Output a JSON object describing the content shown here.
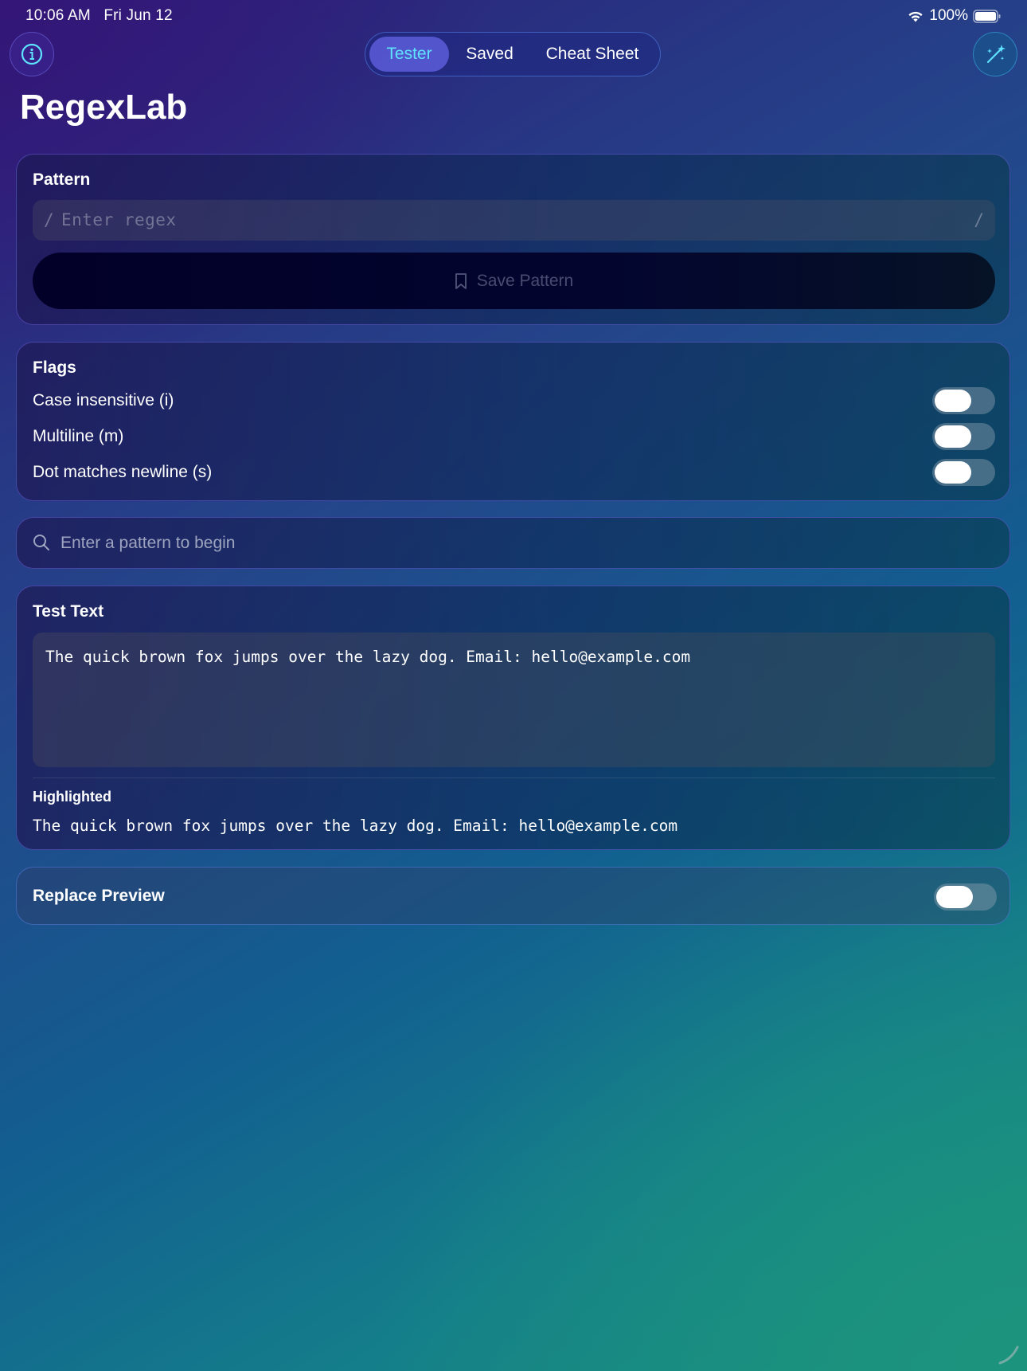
{
  "status_bar": {
    "time": "10:06 AM",
    "date": "Fri Jun 12",
    "battery": "100%"
  },
  "toolbar": {
    "info_icon": "info-circle-icon",
    "magic_icon": "magic-wand-sparkles-icon",
    "tabs": [
      {
        "label": "Tester",
        "selected": true
      },
      {
        "label": "Saved",
        "selected": false
      },
      {
        "label": "Cheat Sheet",
        "selected": false
      }
    ]
  },
  "app_title": "RegexLab",
  "pattern": {
    "label": "Pattern",
    "open_delim": "/",
    "placeholder": "Enter regex",
    "close_delim": "/",
    "save_button": "Save Pattern"
  },
  "flags": {
    "label": "Flags",
    "items": [
      {
        "label": "Case insensitive (i)",
        "enabled": false
      },
      {
        "label": "Multiline (m)",
        "enabled": false
      },
      {
        "label": "Dot matches newline (s)",
        "enabled": false
      }
    ]
  },
  "status": {
    "message": "Enter a pattern to begin"
  },
  "test_text": {
    "label": "Test Text",
    "value": "The quick brown fox jumps over the lazy dog. Email: hello@example.com",
    "highlighted_label": "Highlighted",
    "highlighted_value": "The quick brown fox jumps over the lazy dog. Email: hello@example.com"
  },
  "replace_preview": {
    "label": "Replace Preview",
    "enabled": false
  },
  "colors": {
    "accent": "#5fe3ff",
    "toggle_track": "#8ca0af"
  }
}
